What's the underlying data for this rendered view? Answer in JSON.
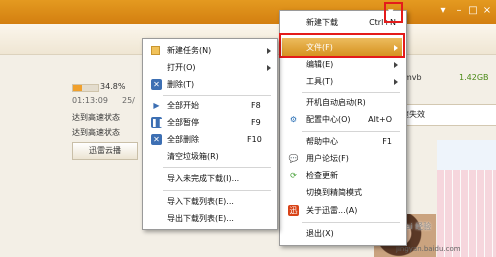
{
  "background": {
    "progress_percent": 34.8,
    "progress_label": "34.8%",
    "time_elapsed": "01:13:09",
    "time_total_partial": "25/",
    "status_1": "达到高速状态",
    "status_2": "达到高速状态",
    "cloud_button": "迅雷云播",
    "file_ext": "mvb",
    "file_size": "1.42GB",
    "right_button_text": "速失效"
  },
  "main_menu": {
    "items": [
      {
        "label": "新建下载",
        "shortcut": "Ctrl+N"
      },
      {
        "label": "文件(F)",
        "highlighted": true
      },
      {
        "label": "编辑(E)"
      },
      {
        "label": "工具(T)"
      },
      {
        "label": "开机自动启动(R)"
      },
      {
        "label": "配置中心(O)",
        "shortcut": "Alt+O"
      },
      {
        "label": "帮助中心",
        "shortcut": "F1"
      },
      {
        "label": "用户论坛(F)"
      },
      {
        "label": "检查更新"
      },
      {
        "label": "切换到精简模式"
      },
      {
        "label": "关于迅雷...(A)"
      },
      {
        "label": "退出(X)"
      }
    ]
  },
  "file_submenu": {
    "items": [
      {
        "label": "新建任务(N)"
      },
      {
        "label": "打开(O)"
      },
      {
        "label": "删除(T)"
      },
      {
        "label": "全部开始",
        "shortcut": "F8"
      },
      {
        "label": "全部暂停",
        "shortcut": "F9"
      },
      {
        "label": "全部删除",
        "shortcut": "F10"
      },
      {
        "label": "清空垃圾箱(R)"
      },
      {
        "label": "导入未完成下载(I)..."
      },
      {
        "label": "导入下载列表(E)..."
      },
      {
        "label": "导出下载列表(E)..."
      }
    ]
  },
  "watermark": {
    "text": "Bai 经验",
    "url": "jingyan.baidu.com"
  },
  "colors": {
    "accent": "#e08f18",
    "highlight_red": "#e41b1b"
  }
}
